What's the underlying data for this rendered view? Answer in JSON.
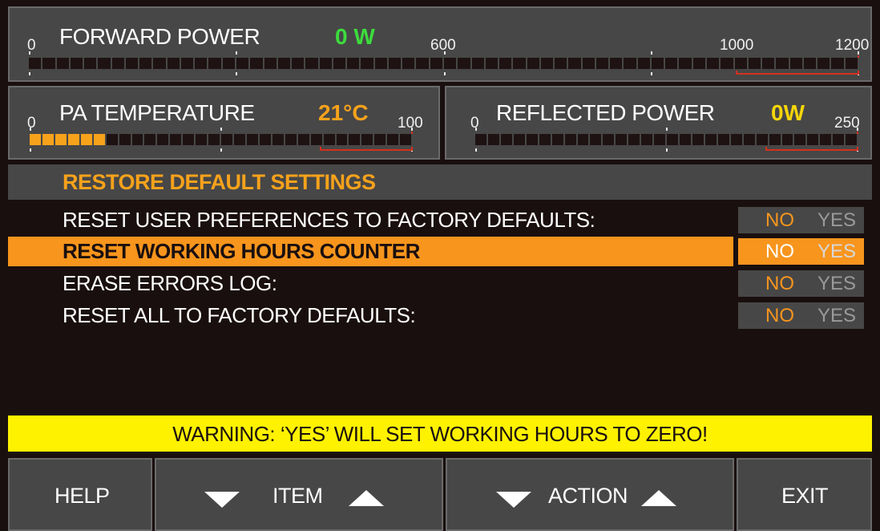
{
  "forward_power": {
    "title": "FORWARD POWER",
    "value": "0 W",
    "value_color": "#3cdc3c",
    "scale": [
      "0",
      "600",
      "1000",
      "1200"
    ],
    "level_fraction": 0
  },
  "pa_temperature": {
    "title": "PA TEMPERATURE",
    "value": "21°C",
    "value_color": "#f7a21b",
    "scale": [
      "0",
      "100"
    ],
    "level_fraction": 0.21
  },
  "reflected_power": {
    "title": "REFLECTED POWER",
    "value": "0W",
    "value_color": "#f5d60a",
    "scale": [
      "0",
      "250"
    ],
    "level_fraction": 0
  },
  "section": {
    "title": "RESTORE DEFAULT SETTINGS"
  },
  "rows": [
    {
      "label": "RESET USER PREFERENCES TO FACTORY DEFAULTS:",
      "no": "NO",
      "yes": "YES"
    },
    {
      "label": "RESET WORKING HOURS COUNTER",
      "no": "NO",
      "yes": "YES"
    },
    {
      "label": "ERASE ERRORS LOG:",
      "no": "NO",
      "yes": "YES"
    },
    {
      "label": "RESET ALL TO FACTORY DEFAULTS:",
      "no": "NO",
      "yes": "YES"
    }
  ],
  "warning": {
    "text": "WARNING: ‘YES’ WILL SET WORKING HOURS TO ZERO!"
  },
  "buttons": {
    "help": "HELP",
    "item": "ITEM",
    "action": "ACTION",
    "exit": "EXIT"
  },
  "colors": {
    "accent": "#f7951d",
    "warning_bg": "#fff200",
    "panel": "#474747",
    "redzone": "#d4301e"
  }
}
